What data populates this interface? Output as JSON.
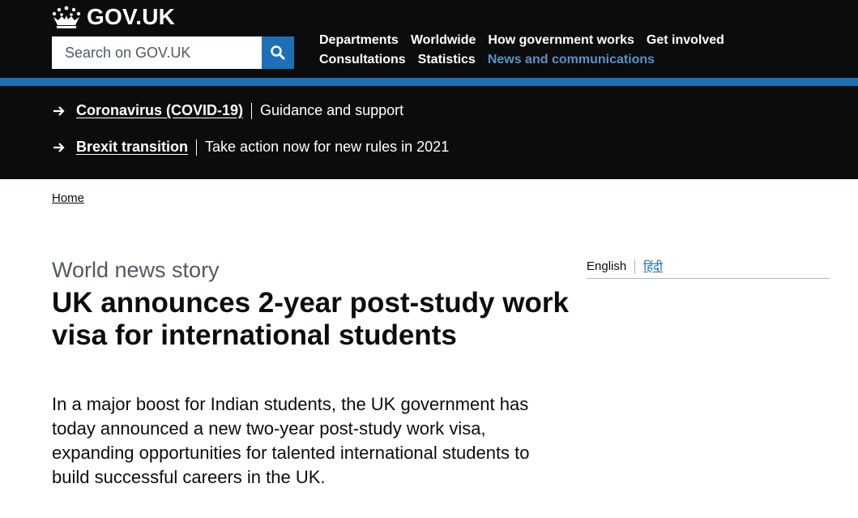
{
  "header": {
    "logo_text": "GOV.UK",
    "search": {
      "placeholder": "Search on GOV.UK"
    },
    "nav": [
      {
        "label": "Departments",
        "active": false
      },
      {
        "label": "Worldwide",
        "active": false
      },
      {
        "label": "How government works",
        "active": false
      },
      {
        "label": "Get involved",
        "active": false
      },
      {
        "label": "Consultations",
        "active": false
      },
      {
        "label": "Statistics",
        "active": false
      },
      {
        "label": "News and communications",
        "active": true
      }
    ]
  },
  "global_bar": {
    "items": [
      {
        "link": "Coronavirus (COVID-19)",
        "text": "Guidance and support"
      },
      {
        "link": "Brexit transition",
        "text": "Take action now for new rules in 2021"
      }
    ]
  },
  "breadcrumb": {
    "home": "Home"
  },
  "article": {
    "caption": "World news story",
    "title": "UK announces 2-year post-study work visa for international students",
    "lead": "In a major boost for Indian students, the UK government has today announced a new two-year post-study work visa, expanding opportunities for talented international students to build successful careers in the UK."
  },
  "translations": {
    "current": "English",
    "other": "हिंदी"
  },
  "colors": {
    "header_bg": "#0b0c0c",
    "brand_blue": "#1d70b8",
    "active_nav": "#5694ca"
  }
}
